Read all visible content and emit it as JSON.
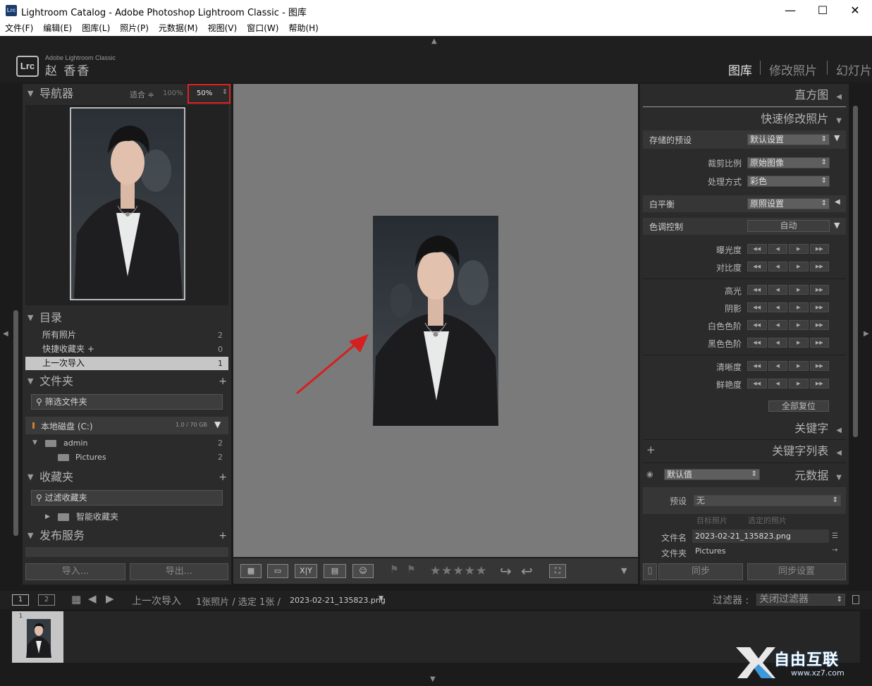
{
  "window": {
    "title": "Lightroom Catalog - Adobe Photoshop Lightroom Classic - 图库",
    "app_icon_text": "Lrc",
    "minimize": "—",
    "maximize": "☐",
    "close": "✕"
  },
  "menu": [
    "文件(F)",
    "编辑(E)",
    "图库(L)",
    "照片(P)",
    "元数据(M)",
    "视图(V)",
    "窗口(W)",
    "帮助(H)"
  ],
  "header": {
    "badge": "Lrc",
    "product": "Adobe Lightroom Classic",
    "user": "赵 香香",
    "modules": [
      "图库",
      "修改照片",
      "幻灯片"
    ],
    "active_module": "图库"
  },
  "navigator": {
    "title": "导航器",
    "fit": "适合 ≑",
    "zoom100": "100%",
    "zoom_selected": "50%",
    "zoom_arrow": "⇕"
  },
  "catalog": {
    "title": "目录",
    "items": [
      {
        "label": "所有照片",
        "count": "2"
      },
      {
        "label": "快捷收藏夹 +",
        "count": "0"
      },
      {
        "label": "上一次导入",
        "count": "1"
      }
    ]
  },
  "folders": {
    "title": "文件夹",
    "filter_placeholder": "筛选文件夹",
    "volume": "本地磁盘 (C:)",
    "volume_space": "1.0 / 70 GB",
    "items": [
      {
        "label": "admin",
        "count": "2"
      },
      {
        "label": "Pictures",
        "count": "2"
      }
    ]
  },
  "collections": {
    "title": "收藏夹",
    "filter_placeholder": "过滤收藏夹",
    "smart": "智能收藏夹"
  },
  "publish": {
    "title": "发布服务"
  },
  "left_buttons": {
    "import": "导入...",
    "export": "导出..."
  },
  "right": {
    "histogram": "直方图",
    "quick_develop": "快速修改照片",
    "saved_preset_label": "存储的预设",
    "saved_preset_value": "默认设置",
    "crop_label": "裁剪比例",
    "crop_value": "原始图像",
    "treatment_label": "处理方式",
    "treatment_value": "彩色",
    "wb_label": "白平衡",
    "wb_value": "原照设置",
    "tone_label": "色调控制",
    "tone_auto": "自动",
    "sliders": [
      "曝光度",
      "对比度",
      "高光",
      "阴影",
      "白色色阶",
      "黑色色阶",
      "清晰度",
      "鲜艳度"
    ],
    "reset_all": "全部复位",
    "keywording": "关键字",
    "keyword_list": "关键字列表",
    "metadata": "元数据",
    "metadata_preset_label": "默认值",
    "preset_label": "预设",
    "preset_value": "无",
    "target_photo": "目标照片",
    "selected_photos": "选定的照片",
    "filename_label": "文件名",
    "filename_value": "2023-02-21_135823.png",
    "folder_label": "文件夹",
    "folder_value": "Pictures",
    "sync": "同步",
    "sync_settings": "同步设置"
  },
  "toolbar": {
    "compare_label": "X|Y",
    "stars": "★★★★★"
  },
  "filmbar": {
    "tab1": "1",
    "tab2": "2",
    "source": "上一次导入",
    "count_text": "1张照片 / 选定 1张 /",
    "filename": "2023-02-21_135823.png",
    "filter_label": "过滤器 :",
    "filter_value": "关闭过滤器"
  },
  "filmstrip": {
    "thumb_index": "1"
  },
  "watermark": {
    "text": "自由互联",
    "url": "www.xz7.com"
  },
  "colors": {
    "highlight_box": "#e02020",
    "arrow": "#d42020",
    "selected_row": "#c6c6c6"
  }
}
